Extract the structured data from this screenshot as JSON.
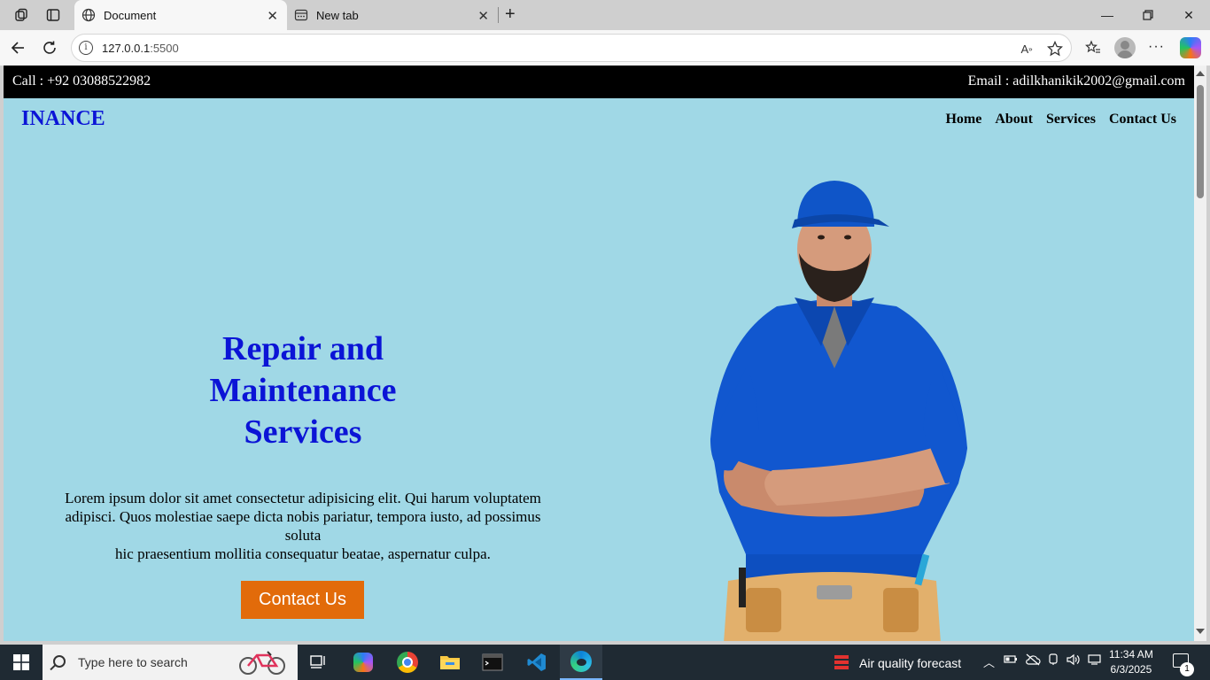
{
  "browser": {
    "tabs": [
      {
        "title": "Document",
        "icon": "globe-icon"
      },
      {
        "title": "New tab",
        "icon": "newtab-icon"
      }
    ],
    "url": "127.0.0.1",
    "url_port": ":5500"
  },
  "page": {
    "topbar": {
      "call": "Call : +92 03088522982",
      "email": "Email : adilkhanikik2002@gmail.com"
    },
    "brand": "INANCE",
    "menu": [
      "Home",
      "About",
      "Services",
      "Contact Us"
    ],
    "hero": {
      "title_line1": "Repair and",
      "title_line2": "Maintenance",
      "title_line3": "Services",
      "text_line1": "Lorem ipsum dolor sit amet consectetur adipisicing elit. Qui harum voluptatem",
      "text_line2": "adipisci. Quos molestiae saepe dicta nobis pariatur, tempora iusto, ad possimus",
      "text_line3": "soluta",
      "text_line4": "hic praesentium mollitia consequatur beatae, aspernatur culpa.",
      "cta": "Contact Us"
    },
    "colors": {
      "brand": "#0b14d6",
      "hero_bg": "#a0d8e6",
      "cta": "#e26b0a"
    }
  },
  "taskbar": {
    "search_placeholder": "Type here to search",
    "weather": "Air quality forecast",
    "time": "11:34 AM",
    "date": "6/3/2025",
    "notification_count": "1"
  }
}
